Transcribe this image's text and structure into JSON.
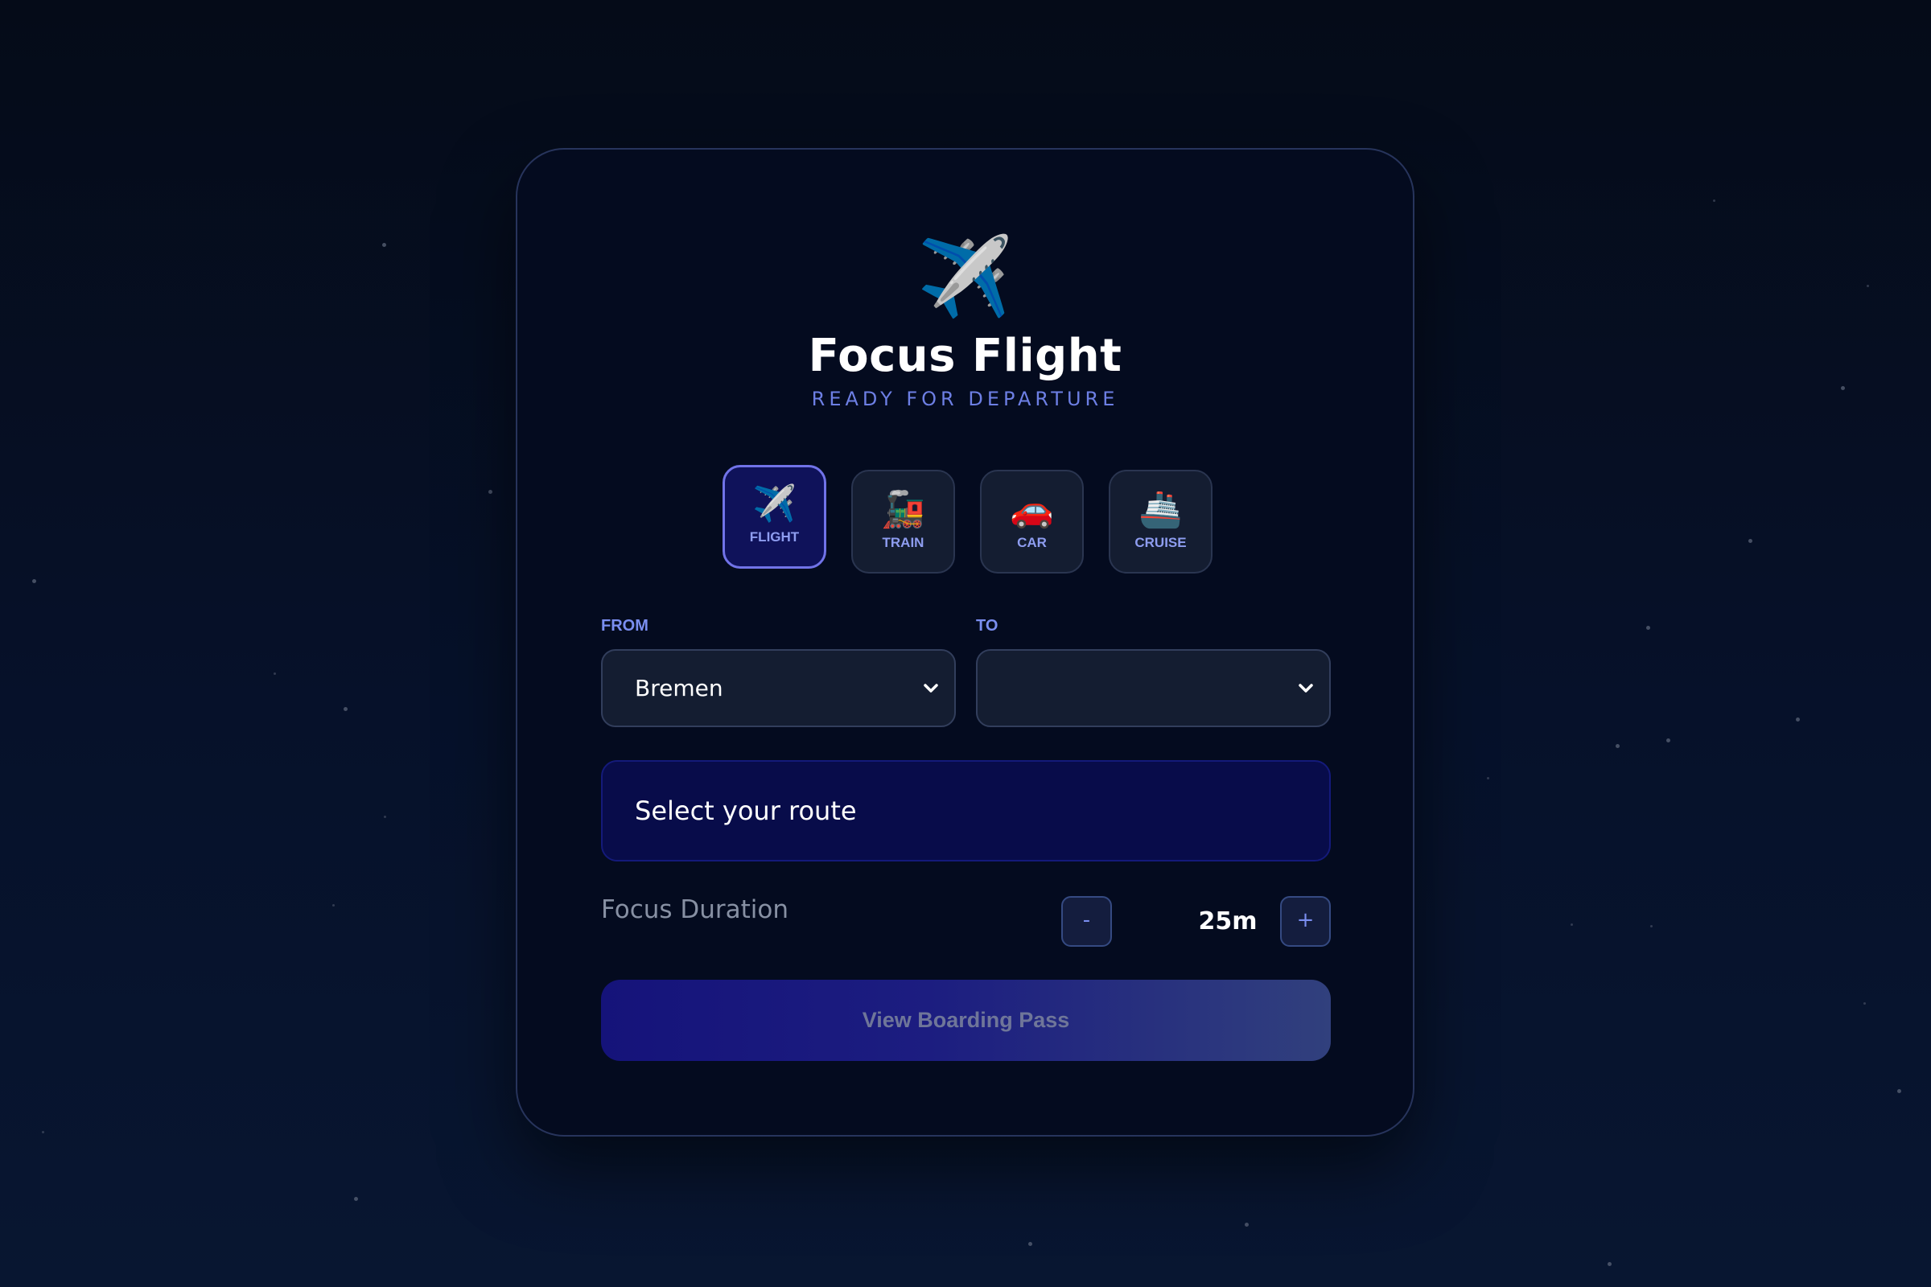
{
  "app": {
    "icon": "airplane-icon",
    "title": "Focus Flight",
    "subtitle": "READY FOR DEPARTURE"
  },
  "modes": [
    {
      "label": "FLIGHT",
      "icon": "airplane-icon",
      "glyph": "✈️",
      "active": true
    },
    {
      "label": "TRAIN",
      "icon": "locomotive-icon",
      "glyph": "🚂",
      "active": false
    },
    {
      "label": "CAR",
      "icon": "car-icon",
      "glyph": "🚗",
      "active": false
    },
    {
      "label": "CRUISE",
      "icon": "ship-icon",
      "glyph": "🚢",
      "active": false
    }
  ],
  "route": {
    "from_label": "FROM",
    "from_value": "Bremen",
    "to_label": "TO",
    "to_value": "",
    "status": "Select your route"
  },
  "duration": {
    "label": "Focus Duration",
    "value": "25m",
    "decrement": "-",
    "increment": "+"
  },
  "actions": {
    "boarding_pass": "View Boarding Pass"
  },
  "colors": {
    "accent": "#6d7fe4",
    "active_mode_bg": "#0f125a",
    "card_bg": "#040b1f"
  }
}
